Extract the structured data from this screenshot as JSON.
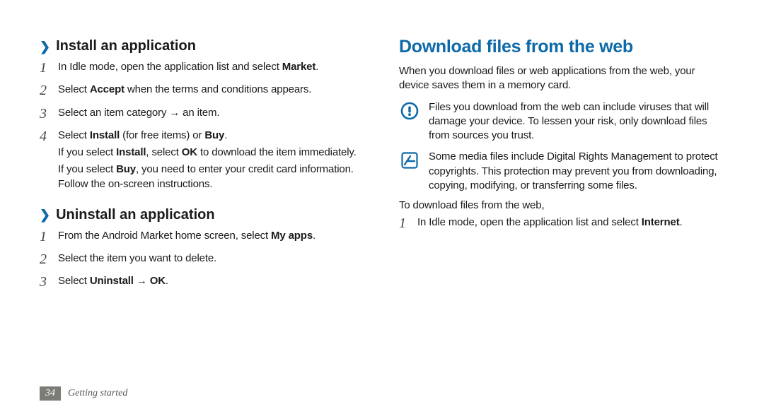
{
  "left": {
    "install": {
      "heading": "Install an application",
      "steps": [
        {
          "num": "1",
          "paras": [
            [
              {
                "t": "In Idle mode, open the application list and select "
              },
              {
                "t": "Market",
                "b": true
              },
              {
                "t": "."
              }
            ]
          ]
        },
        {
          "num": "2",
          "paras": [
            [
              {
                "t": "Select "
              },
              {
                "t": "Accept",
                "b": true
              },
              {
                "t": " when the terms and conditions appears."
              }
            ]
          ]
        },
        {
          "num": "3",
          "paras": [
            [
              {
                "t": "Select an item category → an item."
              }
            ]
          ]
        },
        {
          "num": "4",
          "paras": [
            [
              {
                "t": "Select "
              },
              {
                "t": "Install",
                "b": true
              },
              {
                "t": " (for free items) or "
              },
              {
                "t": "Buy",
                "b": true
              },
              {
                "t": "."
              }
            ],
            [
              {
                "t": "If you select "
              },
              {
                "t": "Install",
                "b": true
              },
              {
                "t": ", select "
              },
              {
                "t": "OK",
                "b": true
              },
              {
                "t": " to download the item immediately."
              }
            ],
            [
              {
                "t": "If you select "
              },
              {
                "t": "Buy",
                "b": true
              },
              {
                "t": ", you need to enter your credit card information. Follow the on-screen instructions."
              }
            ]
          ]
        }
      ]
    },
    "uninstall": {
      "heading": "Uninstall an application",
      "steps": [
        {
          "num": "1",
          "paras": [
            [
              {
                "t": "From the Android Market home screen, select "
              },
              {
                "t": "My apps",
                "b": true
              },
              {
                "t": "."
              }
            ]
          ]
        },
        {
          "num": "2",
          "paras": [
            [
              {
                "t": "Select the item you want to delete."
              }
            ]
          ]
        },
        {
          "num": "3",
          "paras": [
            [
              {
                "t": "Select "
              },
              {
                "t": "Uninstall",
                "b": true
              },
              {
                "t": " → "
              },
              {
                "t": "OK",
                "b": true
              },
              {
                "t": "."
              }
            ]
          ]
        }
      ]
    }
  },
  "right": {
    "title": "Download files from the web",
    "intro": "When you download files or web applications from the web, your device saves them in a memory card.",
    "warning": "Files you download from the web can include viruses that will damage your device. To lessen your risk, only download files from sources you trust.",
    "info": "Some media files include Digital Rights Management to protect copyrights. This protection may prevent you from downloading, copying, modifying, or transferring some files.",
    "lead": "To download files from the web,",
    "steps": [
      {
        "num": "1",
        "paras": [
          [
            {
              "t": "In Idle mode, open the application list and select "
            },
            {
              "t": "Internet",
              "b": true
            },
            {
              "t": "."
            }
          ]
        ]
      }
    ]
  },
  "footer": {
    "page": "34",
    "section": "Getting started"
  }
}
